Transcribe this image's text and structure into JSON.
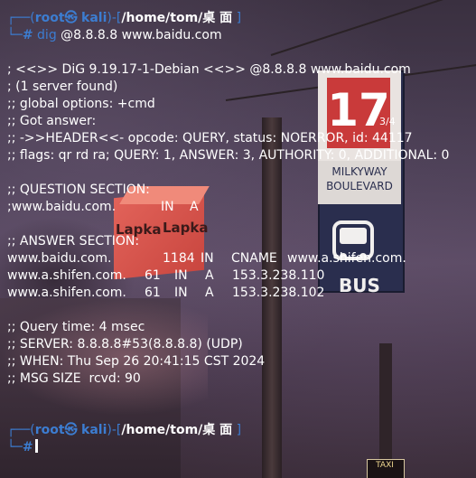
{
  "prompt": {
    "corner_top": "┌──(",
    "user": "root",
    "skull": "㉿",
    "host": "kali",
    "sep": ")-[",
    "path": "/home/tom/桌 面",
    "close": "]",
    "corner_bottom": "└─",
    "hash": "#"
  },
  "command": {
    "name": "dig",
    "args": "@8.8.8.8 www.baidu.com"
  },
  "output": {
    "header_line": "; <<>> DiG 9.19.17-1-Debian <<>> @8.8.8.8 www.baidu.com",
    "servers_found": "; (1 server found)",
    "global_options": ";; global options: +cmd",
    "got_answer": ";; Got answer:",
    "header_status": ";; ->>HEADER<<- opcode: QUERY, status: NOERROR, id: 44117",
    "flags": ";; flags: qr rd ra; QUERY: 1, ANSWER: 3, AUTHORITY: 0, ADDITIONAL: 0",
    "question_section_title": ";; QUESTION SECTION:",
    "question": {
      "name": ";www.baidu.com.",
      "class": "IN",
      "type": "A"
    },
    "answer_section_title": ";; ANSWER SECTION:",
    "answers": [
      {
        "name": "www.baidu.com.",
        "ttl": "1184",
        "class": "IN",
        "type": "CNAME",
        "data": "www.a.shifen.com."
      },
      {
        "name": "www.a.shifen.com.",
        "ttl": "61",
        "class": "IN",
        "type": "A",
        "data": "153.3.238.110"
      },
      {
        "name": "www.a.shifen.com.",
        "ttl": "61",
        "class": "IN",
        "type": "A",
        "data": "153.3.238.102"
      }
    ],
    "query_time": ";; Query time: 4 msec",
    "server": ";; SERVER: 8.8.8.8#53(8.8.8.8) (UDP)",
    "when": ";; WHEN: Thu Sep 26 20:41:15 CST 2024",
    "msg_size": ";; MSG SIZE  rcvd: 90"
  },
  "background": {
    "sign_number": "17",
    "sign_fraction": "3/4",
    "sign_street_1": "MILKYWAY",
    "sign_street_2": "BOULEVARD",
    "sign_bus": "BUS",
    "box_text_1": "Lapka",
    "box_text_2": "Lapka",
    "taxi_text": "TAXI"
  },
  "colors": {
    "prompt_blue": "#3c7dd1",
    "text": "#ffffff",
    "sign_red": "#c93a3a",
    "sign_navy": "#2a2e4e"
  }
}
